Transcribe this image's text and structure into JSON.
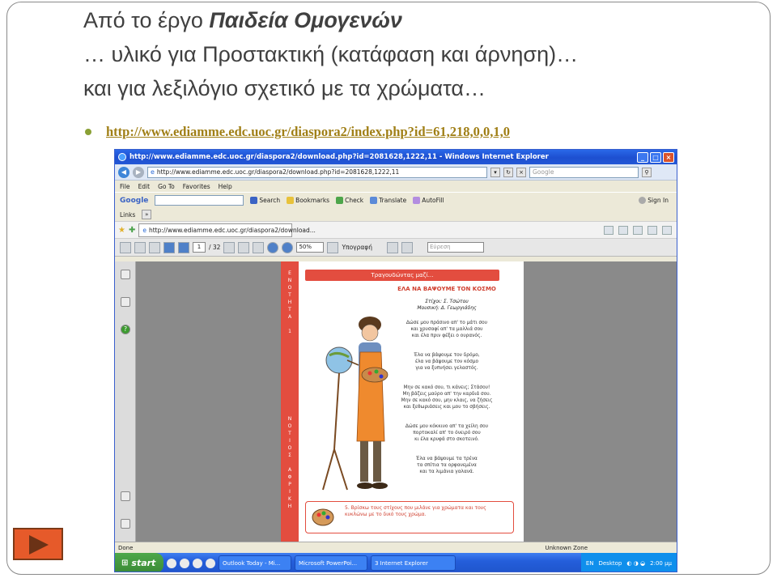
{
  "slide": {
    "title_line1_plain": "Από το έργο ",
    "title_line1_bold": "Παιδεία Ομογενών",
    "title_line2": "… υλικό για Προστακτική (κατάφαση και άρνηση)…",
    "title_line3": "και  για λεξιλόγιο σχετικό με τα χρώματα…",
    "link": "http://www.ediamme.edc.uoc.gr/diaspora2/index.php?id=61,218,0,0,1,0"
  },
  "browser": {
    "window_title": "http://www.ediamme.edc.uoc.gr/diaspora2/download.php?id=2081628,1222,11 - Windows Internet Explorer",
    "address": "http://www.ediamme.edc.uoc.gr/diaspora2/download.php?id=2081628,1222,11",
    "search_placeholder": "Google",
    "menu": [
      "File",
      "Edit",
      "Go To",
      "Favorites",
      "Help"
    ],
    "google_bar": {
      "brand": "Google",
      "items": [
        "Search",
        "Bookmarks",
        "Check",
        "Translate",
        "AutoFill",
        "Sign In"
      ]
    },
    "links_label": "Links",
    "tab_label": "http://www.ediamme.edc.uoc.gr/diaspora2/download...",
    "pdf": {
      "page_current": "1",
      "page_total": "/ 32",
      "zoom": "50%",
      "signature": "Υπογραφή",
      "find_placeholder": "Εύρεση"
    },
    "status_left": "Done",
    "status_zone": "Unknown Zone"
  },
  "document_page": {
    "banner": "Τραγουδώντας μαζί...",
    "song_title": "ΕΛΑ ΝΑ ΒΑΨΟΥΜΕ ΤΟΝ ΚΟΣΜΟ",
    "credits": "Στίχοι: Σ. Τσώτου\nΜουσική: Δ. Γεωργιάδης",
    "stanzas": [
      "Δώσε μου πράσινο απ' το μάτι σου\nκαι χρυσαφί απ' τα μαλλιά σου\nκαι έλα πριν φέξει ο ουρανός.",
      "Έλα να βάψουμε τον δρόμο,\nέλα να βάψουμε τον κόσμο\nγια να ξυπνήσει γελαστός.",
      "Μην σε κακό σου, τι κάνεις; Στάσου!\nΜη βάζεις μαύρο απ' την καρδιά σου.\nΜην σε κακό σου, μην κλαις, να ζήσεις\nκαι ξεθωριάσεις και μου το σβήσεις.",
      "Δώσε μου κόκκινο απ' τα χείλη σου\nπορτοκαλί απ' το όνειρό σου\nκι έλα κρυφά στο σκοτεινό.",
      "Έλα να βάψουμε τα τρένα\nτα σπίτια τα ορφανεμένα\nκαι τα λιμάνια γαλανά."
    ],
    "strip_top": "Ε\nΝ\nΟ\nΤ\nΗ\nΤ\nΑ\n\n1",
    "strip_bottom": "Ν\nΟ\nΤ\nΙ\nΟ\nΣ\n\nΑ\nΦ\nΡ\nΙ\nΚ\nΗ",
    "exercise": "5. Βρίσκω τους στίχους που μιλάνε για χρώματα και τους κυκλώνω με το δικό τους χρώμα."
  },
  "taskbar": {
    "start": "start",
    "tasks": [
      "Outlook Today - Mi...",
      "Microsoft PowerPoi...",
      "3 Internet Explorer"
    ],
    "lang": "EN",
    "desktop": "Desktop",
    "clock": "2:00 μμ"
  },
  "colors": {
    "title_text": "#404040",
    "link": "#a07f16",
    "bullet": "#8aa035",
    "nav_button": "#e65a2a",
    "page_red": "#e34d3f"
  }
}
